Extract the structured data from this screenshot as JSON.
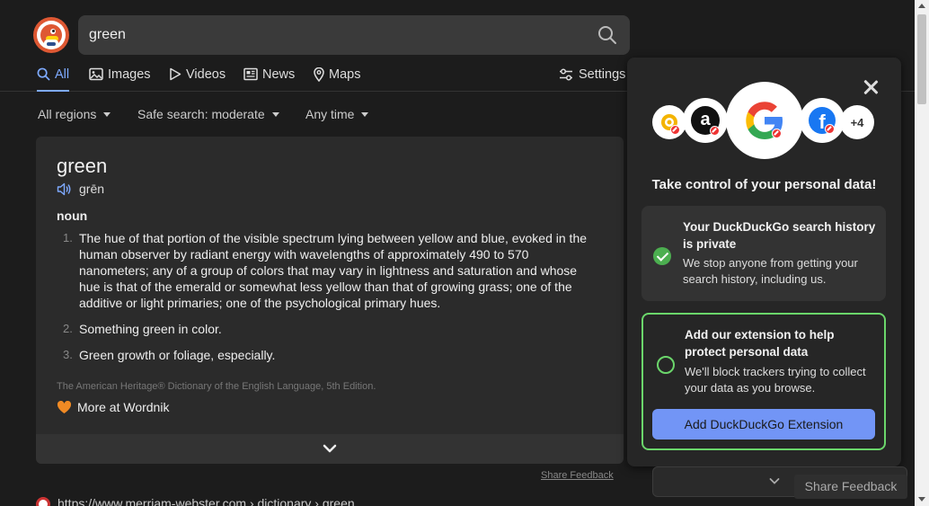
{
  "search": {
    "query": "green"
  },
  "nav": {
    "tabs": [
      {
        "label": "All",
        "icon": "search-icon",
        "active": true
      },
      {
        "label": "Images",
        "icon": "image-icon"
      },
      {
        "label": "Videos",
        "icon": "play-icon"
      },
      {
        "label": "News",
        "icon": "news-icon"
      },
      {
        "label": "Maps",
        "icon": "map-pin-icon"
      }
    ],
    "settings_label": "Settings"
  },
  "filters": {
    "region": "All regions",
    "safe_search": "Safe search: moderate",
    "time": "Any time"
  },
  "dictionary": {
    "word": "green",
    "pronunciation": "grēn",
    "part_of_speech": "noun",
    "definitions": [
      {
        "num": "1.",
        "text": "The hue of that portion of the visible spectrum lying between yellow and blue, evoked in the human observer by radiant energy with wavelengths of approximately 490 to 570 nanometers; any of a group of colors that may vary in lightness and saturation and whose hue is that of the emerald or somewhat less yellow than that of growing grass; one of the additive or light primaries; one of the psychological primary hues."
      },
      {
        "num": "2.",
        "text": "Something green in color."
      },
      {
        "num": "3.",
        "text": "Green growth or foliage, especially."
      }
    ],
    "source": "The American Heritage® Dictionary of the English Language, 5th Edition.",
    "more_link": "More at Wordnik"
  },
  "share_feedback": "Share Feedback",
  "result": {
    "url": "https://www.merriam-webster.com › dictionary › green"
  },
  "privacy_panel": {
    "more_count": "+4",
    "title": "Take control of your personal data!",
    "box1_title": "Your DuckDuckGo search history is private",
    "box1_desc": "We stop anyone from getting your search history, including us.",
    "box2_title": "Add our extension to help protect personal data",
    "box2_desc": "We'll block trackers trying to collect your data as you browse.",
    "button_label": "Add DuckDuckGo Extension"
  },
  "share_feedback_button": "Share Feedback",
  "colors": {
    "accent": "#7eaaff",
    "button": "#7295f6",
    "success": "#6bd66b",
    "logo": "#de5833"
  }
}
